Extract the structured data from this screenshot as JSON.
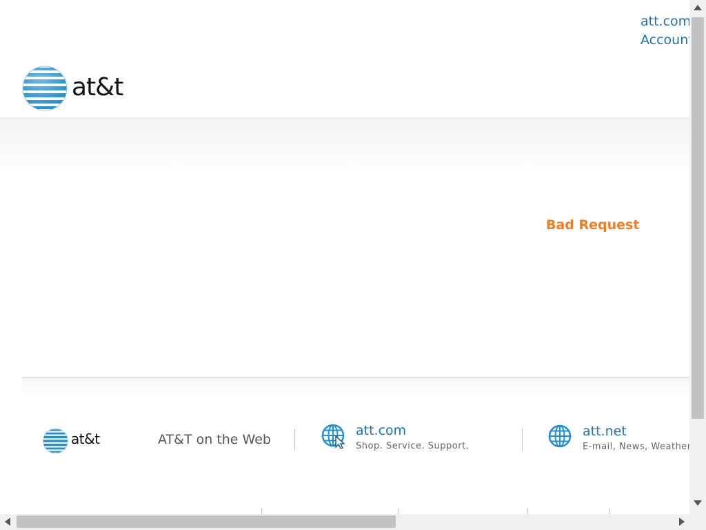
{
  "header": {
    "links": [
      "att.com",
      "Account"
    ],
    "logo_text": "at&t"
  },
  "main": {
    "error_title": "Bad Request"
  },
  "footer": {
    "logo_text": "at&t",
    "web_label": "AT&T on the Web",
    "sites": [
      {
        "title": "att.com",
        "subtitle": "Shop. Service. Support."
      },
      {
        "title": "att.net",
        "subtitle": "E-mail, News, Weather"
      }
    ]
  },
  "colors": {
    "link_blue": "#1a73b5",
    "error_orange": "#f47b20",
    "globe_blue": "#1e8ed6"
  }
}
